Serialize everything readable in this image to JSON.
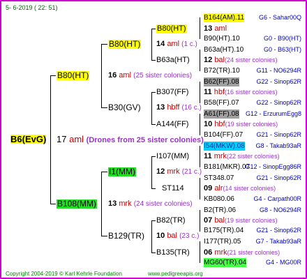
{
  "date": "5-  6-2019 ( 22: 51)",
  "root": {
    "name": "B6(EvG)",
    "year": "17",
    "sign": "aml",
    "note": "(Drones from 25 sister colonies)"
  },
  "g2": {
    "upper": "B80(HT)",
    "upper_year": "16",
    "upper_sign": "aml",
    "upper_note": "(25 sister colonies)",
    "lower": "B108(MM)",
    "lower_year": "13",
    "lower_sign": "mrk",
    "lower_note": "(24 sister colonies)"
  },
  "g3": {
    "a": "B80(HT)",
    "a_year": "14",
    "a_sign": "aml",
    "a_note": "(1 c.)",
    "b": "B30(GV)",
    "b_year": "13",
    "b_sign": "hbff",
    "b_note": "(16 c.)",
    "c": "I1(MM)",
    "c_year": "12",
    "c_sign": "mrk",
    "c_note": "(21 c.)",
    "d": "B129(TR)",
    "d_year": "10",
    "d_sign": "bal",
    "d_note": "(23 c.)"
  },
  "g4": [
    "B80(HT)",
    "B63a(HT)",
    "B307(FF)",
    "A144(FF)",
    "I107(MM)",
    "ST114",
    "B82(TR)",
    "B135(TR)"
  ],
  "g4i": [
    {
      "y": "13",
      "s": "aml",
      "n": ""
    },
    {
      "y": "12",
      "s": "bal",
      "n": "(24 sister colonies)"
    },
    {
      "y": "11",
      "s": "hbf",
      "n": "(16 sister colonies)"
    },
    {
      "y": "10",
      "s": "hbf",
      "n": "(19 sister colonies)"
    },
    {
      "y": "11",
      "s": "mrk",
      "n": "(22 sister colonies)"
    },
    {
      "y": "09",
      "s": "alr",
      "n": "(14 sister colonies)"
    },
    {
      "y": "07",
      "s": "bal",
      "n": "(19 sister colonies)"
    },
    {
      "y": "06",
      "s": "mrk",
      "n": "(21 sister colonies)"
    }
  ],
  "g5": [
    {
      "name": "B164(AM).11",
      "label": "G6 - Sahar00Q"
    },
    {
      "name": "B90(HT).10",
      "label": "G0 - B90(HT)"
    },
    {
      "name": "B63a(HT).10",
      "label": "G0 - B63(HT)"
    },
    {
      "name": "B72(TR).10",
      "label": "G11 - NO6294R"
    },
    {
      "name": "B62(FF).08",
      "label": "G22 - Sinop62R"
    },
    {
      "name": "B58(FF).07",
      "label": "G22 - Sinop62R"
    },
    {
      "name": "A61(FF).08",
      "label": "G12 - ErzurumEgg8"
    },
    {
      "name": "B104(FF).07",
      "label": "G21 - Sinop62R"
    },
    {
      "name": "I54(MKW).08",
      "label": "G8 - Takab93aR"
    },
    {
      "name": "B181(MKR).07",
      "label": "G12 - SinopEgg86R"
    },
    {
      "name": "ST348.07",
      "label": "G21 - Sinop62R"
    },
    {
      "name": "KB080.06",
      "label": "G4 - Carpath00R"
    },
    {
      "name": "B2(TR).06",
      "label": "G8 - NO6294R"
    },
    {
      "name": "B175(TR).04",
      "label": "G21 - Sinop62R"
    },
    {
      "name": "I177(TR).05",
      "label": "G7 - Takab93aR"
    },
    {
      "name": "MG60(TR).04",
      "label": "G4 - MG00R"
    }
  ],
  "footer": {
    "copyright": "Copyright 2004-2019 © Karl Kehrle Foundation",
    "website": "www.pedigreeapis.org"
  }
}
